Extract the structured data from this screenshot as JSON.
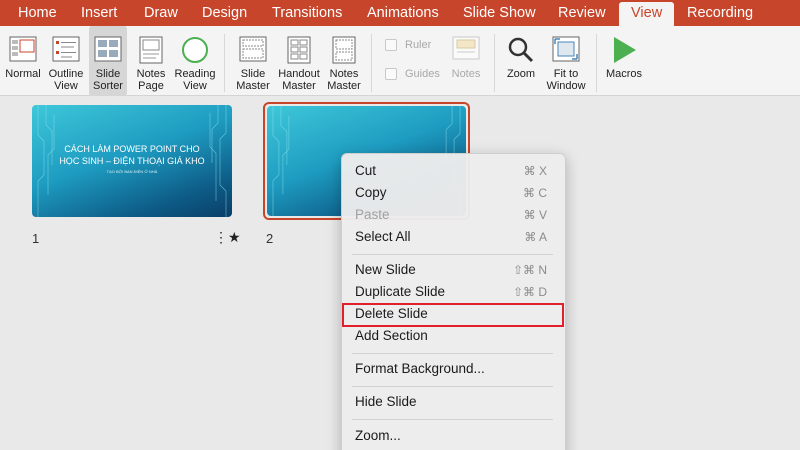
{
  "tabs": [
    "Home",
    "Insert",
    "Draw",
    "Design",
    "Transitions",
    "Animations",
    "Slide Show",
    "Review",
    "View",
    "Recording"
  ],
  "active_tab": "View",
  "ribbon": {
    "normal": "Normal",
    "outline_view": [
      "Outline",
      "View"
    ],
    "slide_sorter": [
      "Slide",
      "Sorter"
    ],
    "notes_page": [
      "Notes",
      "Page"
    ],
    "reading_view": [
      "Reading",
      "View"
    ],
    "slide_master": [
      "Slide",
      "Master"
    ],
    "handout_master": [
      "Handout",
      "Master"
    ],
    "notes_master": [
      "Notes",
      "Master"
    ],
    "ruler": "Ruler",
    "guides": "Guides",
    "notes": "Notes",
    "zoom": "Zoom",
    "fit_to_window": [
      "Fit to",
      "Window"
    ],
    "macros": "Macros"
  },
  "slides": [
    {
      "number": "1",
      "title_line1": "CÁCH LÀM POWER POINT CHO",
      "title_line2": "HỌC SINH – ĐIỆN THOẠI GIÁ KHO",
      "subtitle": "TẠO BỞI BẠN ĐIỆN Ở NHÀ",
      "badge": "⋮★"
    },
    {
      "number": "2"
    }
  ],
  "context_menu": {
    "cut": {
      "label": "Cut",
      "shortcut": "⌘ X"
    },
    "copy": {
      "label": "Copy",
      "shortcut": "⌘ C"
    },
    "paste": {
      "label": "Paste",
      "shortcut": "⌘ V"
    },
    "select_all": {
      "label": "Select All",
      "shortcut": "⌘ A"
    },
    "new_slide": {
      "label": "New Slide",
      "shortcut": "⇧⌘ N"
    },
    "duplicate_slide": {
      "label": "Duplicate Slide",
      "shortcut": "⇧⌘ D"
    },
    "delete_slide": {
      "label": "Delete Slide"
    },
    "add_section": {
      "label": "Add Section"
    },
    "format_background": {
      "label": "Format Background..."
    },
    "hide_slide": {
      "label": "Hide Slide"
    },
    "zoom": {
      "label": "Zoom..."
    }
  },
  "colors": {
    "accent": "#c7452b",
    "highlight": "#e0202a"
  }
}
